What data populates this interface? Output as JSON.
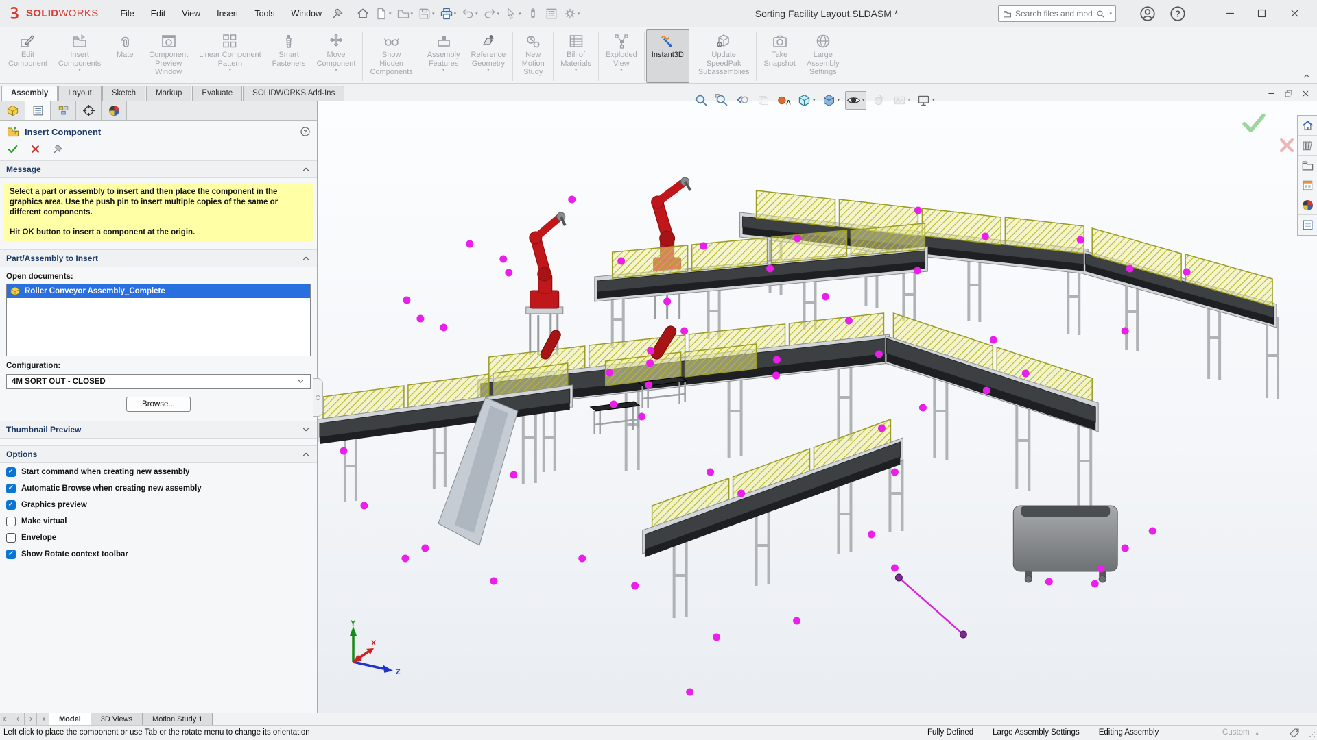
{
  "title_bar": {
    "logo_solid": "SOLID",
    "logo_works": "WORKS",
    "menus": [
      "File",
      "Edit",
      "View",
      "Insert",
      "Tools",
      "Window"
    ],
    "quick_tools": [
      {
        "name": "home-button",
        "icon": "home",
        "caret": false
      },
      {
        "name": "new-document-button",
        "icon": "new-doc",
        "caret": true
      },
      {
        "name": "open-document-button",
        "icon": "open-doc",
        "caret": true
      },
      {
        "name": "save-button",
        "icon": "save",
        "caret": true
      },
      {
        "name": "print-button",
        "icon": "print",
        "caret": true
      },
      {
        "name": "undo-button",
        "icon": "undo",
        "caret": true
      },
      {
        "name": "redo-button",
        "icon": "redo",
        "caret": true
      },
      {
        "name": "select-button",
        "icon": "cursor",
        "caret": true
      },
      {
        "name": "stylus-button",
        "icon": "stylus",
        "caret": false
      },
      {
        "name": "properties-button",
        "icon": "props-list",
        "caret": false
      },
      {
        "name": "options-button",
        "icon": "gear",
        "caret": true
      }
    ],
    "document_title": "Sorting Facility Layout.SLDASM *",
    "search_placeholder": "Search files and models"
  },
  "ribbon": {
    "groups": [
      {
        "buttons": [
          {
            "label": "Edit\nComponent",
            "icon": "edit-component"
          },
          {
            "label": "Insert\nComponents",
            "icon": "insert-components",
            "caret": true
          },
          {
            "label": "Mate",
            "icon": "mate"
          },
          {
            "label": "Component\nPreview\nWindow",
            "icon": "component-preview"
          },
          {
            "label": "Linear Component\nPattern",
            "icon": "linear-pattern",
            "caret": true
          },
          {
            "label": "Smart\nFasteners",
            "icon": "smart-fasteners"
          },
          {
            "label": "Move\nComponent",
            "icon": "move-component",
            "caret": true
          }
        ]
      },
      {
        "buttons": [
          {
            "label": "Show\nHidden\nComponents",
            "icon": "show-hidden"
          }
        ]
      },
      {
        "buttons": [
          {
            "label": "Assembly\nFeatures",
            "icon": "assembly-features",
            "caret": true
          },
          {
            "label": "Reference\nGeometry",
            "icon": "reference-geometry",
            "caret": true
          }
        ]
      },
      {
        "buttons": [
          {
            "label": "New\nMotion\nStudy",
            "icon": "new-motion-study"
          }
        ]
      },
      {
        "buttons": [
          {
            "label": "Bill of\nMaterials",
            "icon": "bill-of-materials",
            "caret": true
          }
        ]
      },
      {
        "buttons": [
          {
            "label": "Exploded\nView",
            "icon": "exploded-view",
            "caret": true
          }
        ]
      },
      {
        "buttons": [
          {
            "label": "Instant3D",
            "icon": "instant3d",
            "active": true
          }
        ]
      },
      {
        "buttons": [
          {
            "label": "Update\nSpeedPak\nSubassemblies",
            "icon": "update-speedpak"
          }
        ]
      },
      {
        "buttons": [
          {
            "label": "Take\nSnapshot",
            "icon": "take-snapshot"
          },
          {
            "label": "Large\nAssembly\nSettings",
            "icon": "large-assembly-settings"
          }
        ]
      }
    ]
  },
  "command_tabs": {
    "items": [
      "Assembly",
      "Layout",
      "Sketch",
      "Markup",
      "Evaluate",
      "SOLIDWORKS Add-Ins"
    ],
    "active_index": 0
  },
  "property_manager": {
    "tabs": [
      {
        "name": "feature-manager-tab",
        "icon": "asm-cube"
      },
      {
        "name": "property-manager-tab",
        "icon": "property-manager",
        "active": true
      },
      {
        "name": "configuration-manager-tab",
        "icon": "configuration-manager"
      },
      {
        "name": "dimxpert-tab",
        "icon": "dimxpert"
      },
      {
        "name": "display-manager-tab",
        "icon": "color-wheel"
      }
    ],
    "title": "Insert Component",
    "sections": {
      "message": {
        "header": "Message",
        "body_line1": "Select a part or assembly to insert and then place the component in the graphics area. Use the push pin to insert multiple copies of the same or different components.",
        "body_line2": "Hit OK button to insert a component at the origin."
      },
      "part_assembly": {
        "header": "Part/Assembly to Insert",
        "open_documents_label": "Open documents:",
        "documents": [
          {
            "name": "Roller Conveyor Assembly_Complete",
            "selected": true
          }
        ],
        "configuration_label": "Configuration:",
        "configuration_value": "4M SORT OUT - CLOSED",
        "browse_label": "Browse..."
      },
      "thumbnail": {
        "header": "Thumbnail Preview"
      },
      "options": {
        "header": "Options",
        "checkboxes": [
          {
            "label": "Start command when creating new assembly",
            "checked": true
          },
          {
            "label": "Automatic Browse when creating new assembly",
            "checked": true
          },
          {
            "label": "Graphics preview",
            "checked": true
          },
          {
            "label": "Make virtual",
            "checked": false
          },
          {
            "label": "Envelope",
            "checked": false
          },
          {
            "label": "Show Rotate context toolbar",
            "checked": true
          }
        ]
      }
    }
  },
  "viewport": {
    "headsup_tools": [
      {
        "name": "zoom-to-fit-button",
        "icon": "zoom-to-fit"
      },
      {
        "name": "zoom-to-area-button",
        "icon": "zoom-to-area"
      },
      {
        "name": "previous-view-button",
        "icon": "previous-view"
      },
      {
        "name": "section-view-button",
        "icon": "section-view",
        "disabled": true
      },
      {
        "name": "edit-appearance-text-button",
        "icon": "appearance-a"
      },
      {
        "name": "view-orientation-button",
        "icon": "view-orientation",
        "caret": true
      },
      {
        "name": "display-style-button",
        "icon": "display-style",
        "caret": true
      },
      {
        "name": "hide-show-items-button",
        "icon": "eye",
        "caret": true,
        "pressed": true
      },
      {
        "name": "edit-appearance-button",
        "icon": "appearance-ball",
        "disabled": true
      },
      {
        "name": "apply-scene-button",
        "icon": "apply-scene",
        "disabled": true,
        "caret": true
      },
      {
        "name": "view-settings-button",
        "icon": "view-settings",
        "caret": true
      }
    ],
    "triad": {
      "x_label": "X",
      "y_label": "Y",
      "z_label": "Z"
    }
  },
  "task_pane": {
    "icons": [
      {
        "name": "taskpane-home-tab",
        "icon": "tp-home"
      },
      {
        "name": "taskpane-design-library-tab",
        "icon": "tp-library"
      },
      {
        "name": "taskpane-file-explorer-tab",
        "icon": "tp-folder"
      },
      {
        "name": "taskpane-view-palette-tab",
        "icon": "tp-palette"
      },
      {
        "name": "taskpane-appearances-tab",
        "icon": "color-wheel"
      },
      {
        "name": "taskpane-custom-properties-tab",
        "icon": "tp-props"
      }
    ]
  },
  "bottom_tabs": {
    "nav_icons": [
      "tab-first",
      "tab-prev",
      "tab-next",
      "tab-last"
    ],
    "items": [
      "Model",
      "3D Views",
      "Motion Study 1"
    ],
    "active_index": 0
  },
  "status_bar": {
    "message": "Left click to place the component or use Tab or the rotate menu to change its orientation",
    "right_items": [
      "Fully Defined",
      "Large Assembly Settings",
      "Editing Assembly"
    ],
    "custom_label": "Custom"
  }
}
